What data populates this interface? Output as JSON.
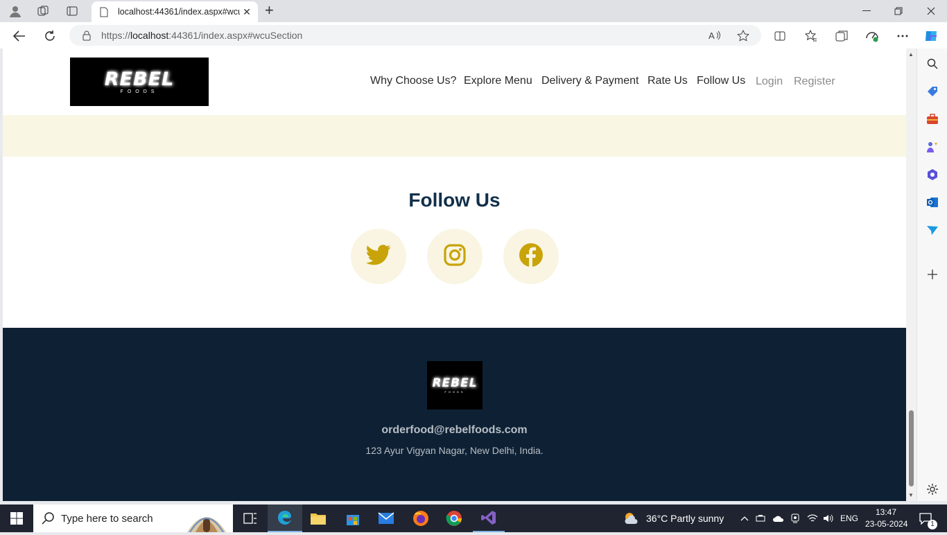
{
  "browser": {
    "tab_title": "localhost:44361/index.aspx#wcuS",
    "url_prefix": "https://",
    "url_host": "localhost",
    "url_rest": ":44361/index.aspx#wcuSection"
  },
  "site": {
    "logo_text": "REBEL",
    "logo_sub": "FOODS",
    "nav": [
      {
        "label": "Why Choose Us?"
      },
      {
        "label": "Explore Menu"
      },
      {
        "label": "Delivery & Payment"
      },
      {
        "label": "Rate Us"
      },
      {
        "label": "Follow Us"
      },
      {
        "label": "Login"
      },
      {
        "label": "Register"
      }
    ],
    "follow_title": "Follow Us",
    "social": [
      "twitter-icon",
      "instagram-icon",
      "facebook-icon"
    ],
    "footer_email": "orderfood@rebelfoods.com",
    "footer_address": "123 Ayur Vigyan Nagar, New Delhi, India."
  },
  "colors": {
    "accent": "#c8a30a",
    "navy": "#0e2134",
    "cream": "#f9f6e4"
  },
  "taskbar": {
    "search_placeholder": "Type here to search",
    "weather": "36°C  Partly sunny",
    "lang": "ENG",
    "time": "13:47",
    "date": "23-05-2024",
    "notifications": "1"
  }
}
